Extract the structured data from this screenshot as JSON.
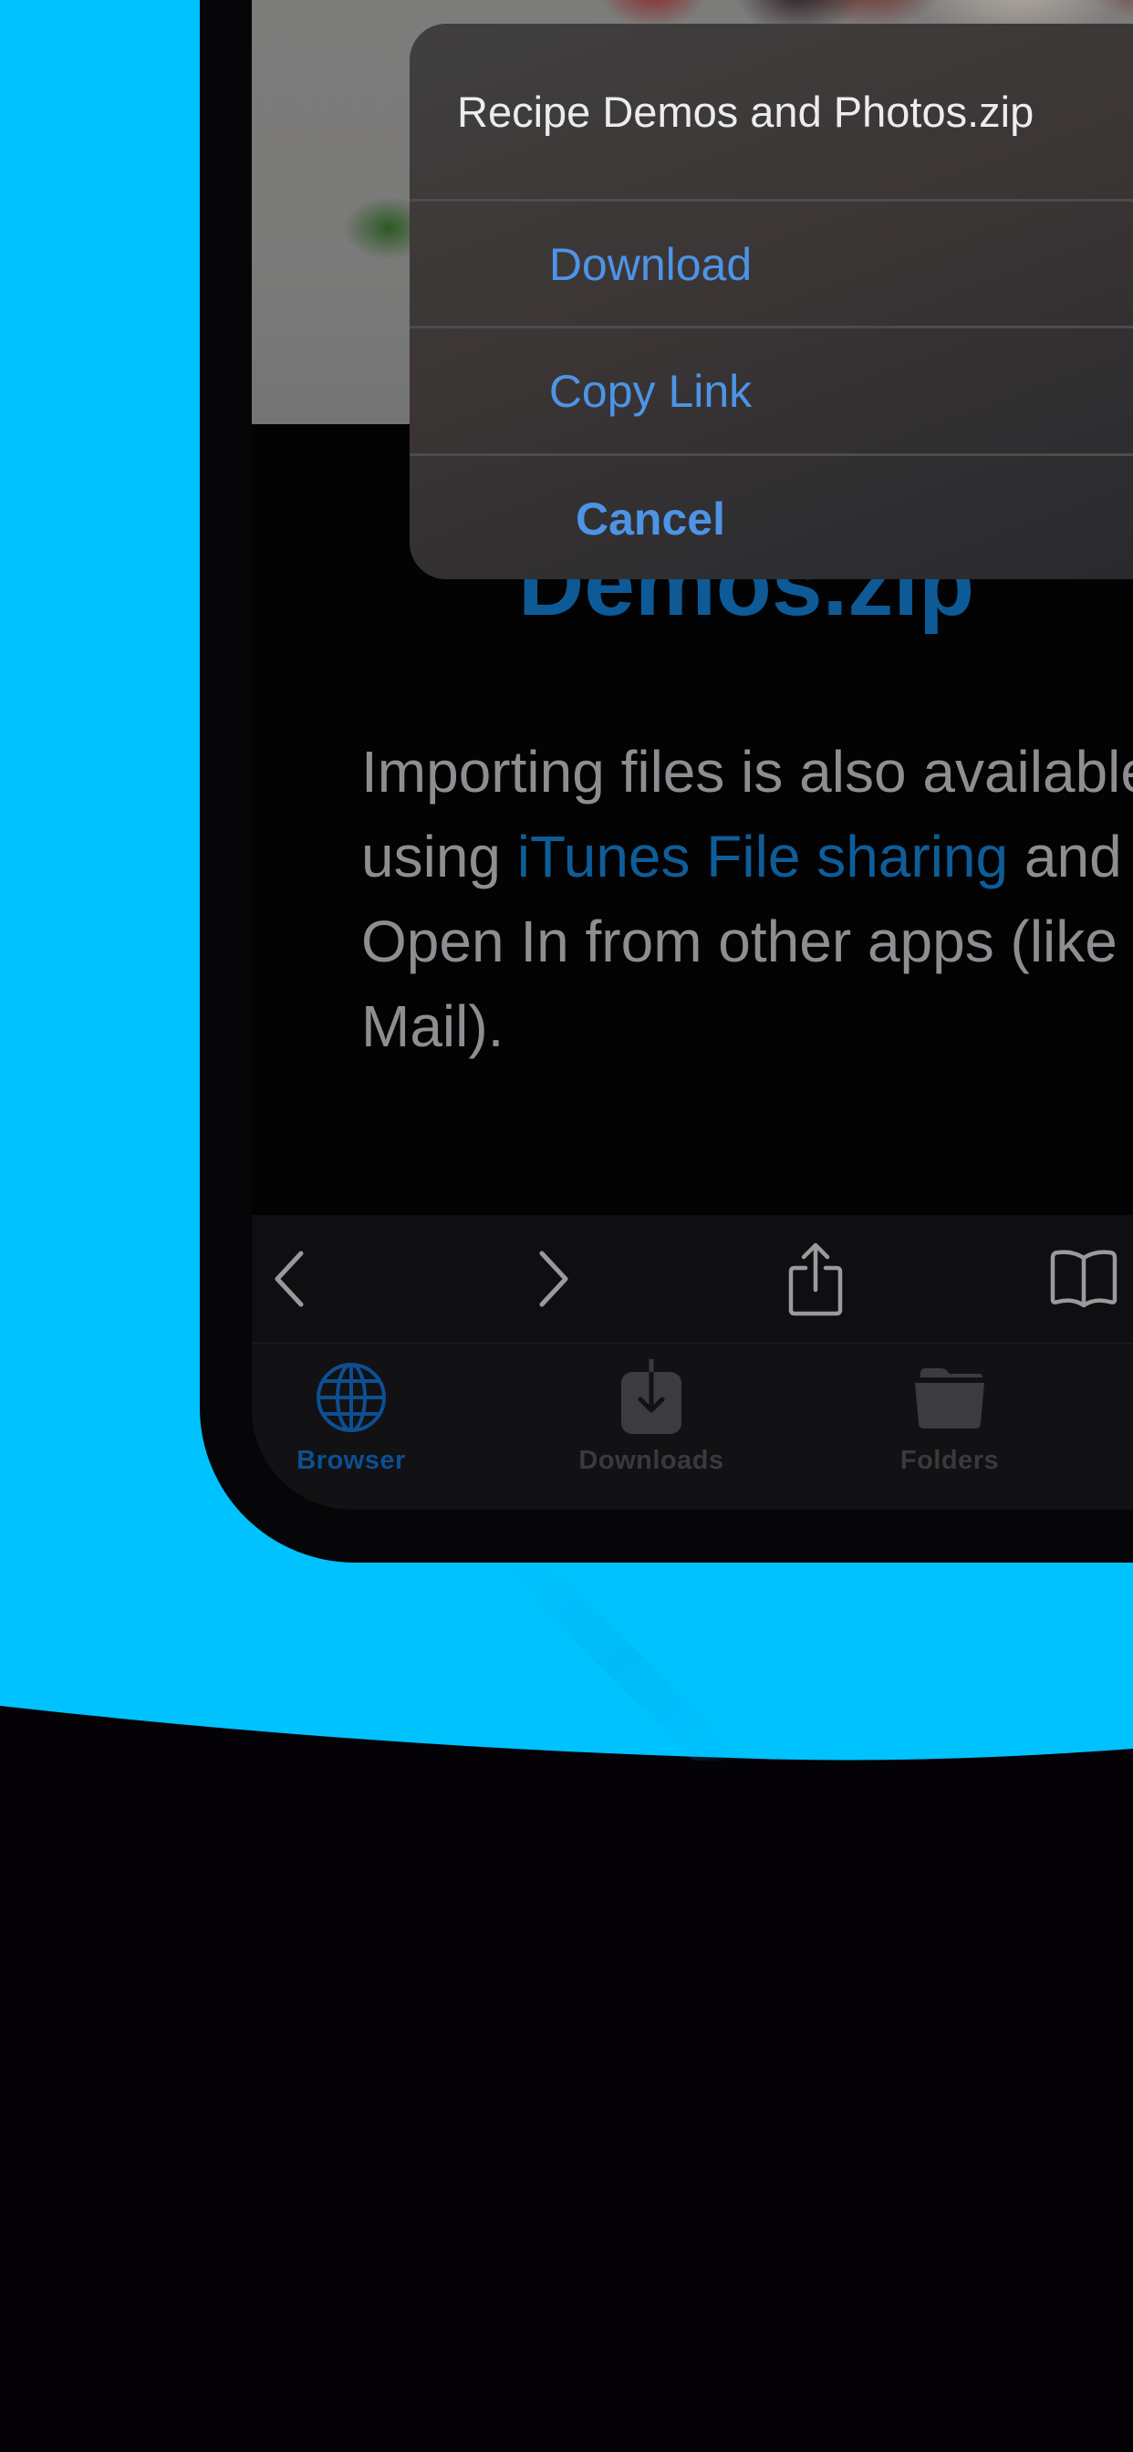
{
  "colors": {
    "backdrop_blue": "#00c2ff",
    "accent_blue": "#4d94e6",
    "link_blue": "#0e5d98",
    "active_tab_blue": "#0d4f93",
    "body_text_gray": "#8e8e92",
    "page_background": "#040206"
  },
  "action_sheet": {
    "title": "Recipe Demos and Photos.zip",
    "actions": [
      {
        "label": "Download",
        "style": "default"
      },
      {
        "label": "Copy Link",
        "style": "default"
      },
      {
        "label": "Cancel",
        "style": "cancel"
      }
    ]
  },
  "page": {
    "heading_partial": "Demos.zip",
    "body_segments": [
      {
        "text": "Importing files is also available using ",
        "link": false
      },
      {
        "text": "iTunes File sharing",
        "link": true
      },
      {
        "text": " and Open In from other apps (like Mail).",
        "link": false
      }
    ]
  },
  "toolbar": {
    "buttons": [
      {
        "icon": "chevron-left-icon",
        "name": "back"
      },
      {
        "icon": "chevron-right-icon",
        "name": "forward"
      },
      {
        "icon": "share-icon",
        "name": "share"
      },
      {
        "icon": "book-icon",
        "name": "bookmarks"
      }
    ]
  },
  "tabbar": {
    "tabs": [
      {
        "label": "Browser",
        "icon": "globe-icon",
        "active": true
      },
      {
        "label": "Downloads",
        "icon": "download-tray-icon",
        "active": false
      },
      {
        "label": "Folders",
        "icon": "folder-icon",
        "active": false
      }
    ]
  }
}
